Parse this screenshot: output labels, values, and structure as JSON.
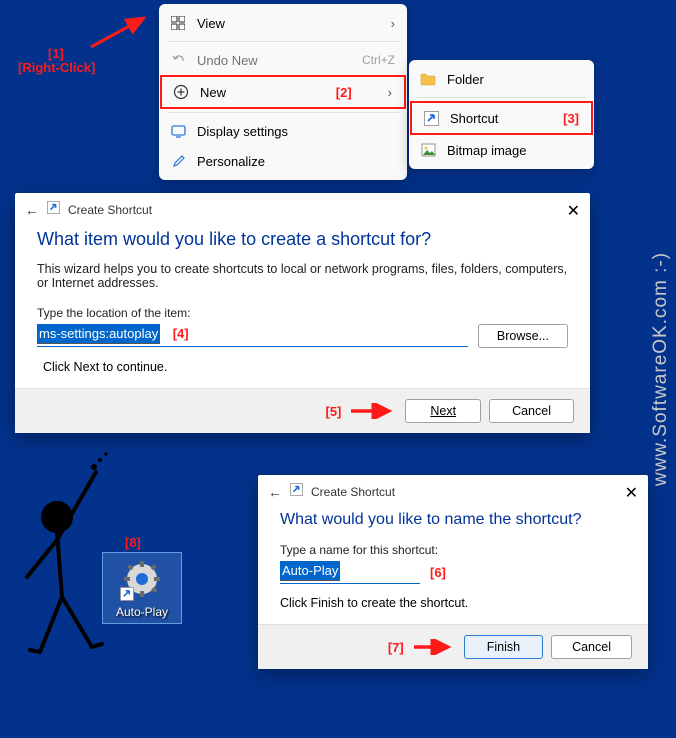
{
  "ctx1": {
    "view": "View",
    "undo": "Undo New",
    "undo_sc": "Ctrl+Z",
    "new": "New",
    "display": "Display settings",
    "personalize": "Personalize"
  },
  "ctx2": {
    "folder": "Folder",
    "shortcut": "Shortcut",
    "bitmap": "Bitmap image"
  },
  "dlg1": {
    "title": "Create Shortcut",
    "heading": "What item would you like to create a shortcut for?",
    "desc": "This wizard helps you to create shortcuts to local or network programs, files, folders, computers, or Internet addresses.",
    "loc_label": "Type the location of the item:",
    "loc_value": "ms-settings:autoplay",
    "browse": "Browse...",
    "hint": "Click Next to continue.",
    "next": "Next",
    "cancel": "Cancel"
  },
  "dlg2": {
    "title": "Create Shortcut",
    "heading": "What would you like to name the shortcut?",
    "name_label": "Type a name for this shortcut:",
    "name_value": "Auto-Play",
    "hint": "Click Finish to create the shortcut.",
    "finish": "Finish",
    "cancel": "Cancel"
  },
  "desk": {
    "label": "Auto-Play"
  },
  "ann": {
    "a1_a": "[1]",
    "a1_b": "[Right-Click]",
    "a2": "[2]",
    "a3": "[3]",
    "a4": "[4]",
    "a5": "[5]",
    "a6": "[6]",
    "a7": "[7]",
    "a8": "[8]"
  },
  "wm": {
    "v": "www.SoftwareOK.com :-)",
    "h": "www.SoftwareOK.com :-)"
  }
}
